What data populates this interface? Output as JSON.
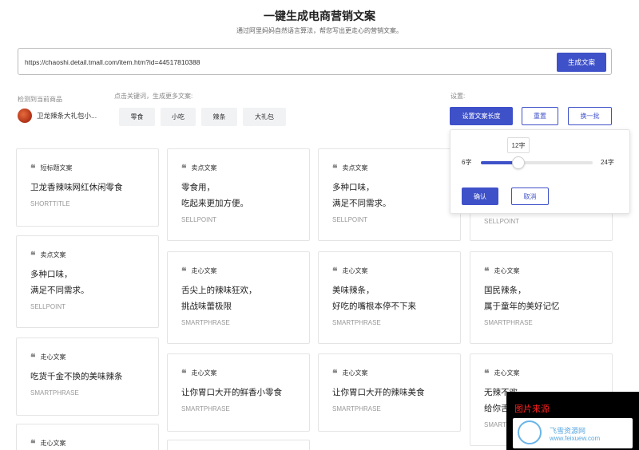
{
  "header": {
    "title": "一键生成电商营销文案",
    "subtitle": "通过阿里妈妈自然语言算法，帮您写出更走心的营销文案。"
  },
  "url_bar": {
    "value": "https://chaoshi.detail.tmall.com/item.htm?id=44517810388",
    "generate_label": "生成文案"
  },
  "product_section": {
    "label": "检测到当前商品",
    "name": "卫龙辣条大礼包小..."
  },
  "keywords_section": {
    "label": "点击关键词，生成更多文案:",
    "keywords": [
      "零食",
      "小吃",
      "辣条",
      "大礼包"
    ]
  },
  "settings": {
    "label": "设置:",
    "length_label": "设置文案长度",
    "reset_label": "重置",
    "refresh_label": "换一批"
  },
  "length_popover": {
    "current": "12字",
    "min_label": "6字",
    "max_label": "24字",
    "min": 6,
    "max": 24,
    "value": 12,
    "ok_label": "确认",
    "cancel_label": "取消"
  },
  "cards": [
    {
      "tag": "短标题文案",
      "content": "卫龙香辣味网红休闲零食",
      "type": "SHORTTITLE"
    },
    {
      "tag": "卖点文案",
      "content": "多种口味，\n满足不同需求。",
      "type": "SELLPOINT"
    },
    {
      "tag": "走心文案",
      "content": "吃货千金不换的美味辣条",
      "type": "SMARTPHRASE"
    },
    {
      "tag": "走心文案",
      "content": "",
      "type": ""
    },
    {
      "tag": "卖点文案",
      "content": "零食用，\n吃起来更加方便。",
      "type": "SELLPOINT"
    },
    {
      "tag": "走心文案",
      "content": "舌尖上的辣味狂欢，\n挑战味蕾极限",
      "type": "SMARTPHRASE"
    },
    {
      "tag": "走心文案",
      "content": "让你胃口大开的鲜香小零食",
      "type": "SMARTPHRASE"
    },
    {
      "tag": "卖点文案",
      "content": "多种口味，\n满足不同需求。",
      "type": "SELLPOINT"
    },
    {
      "tag": "走心文案",
      "content": "美味辣条，\n好吃的嘴根本停不下来",
      "type": "SMARTPHRASE"
    },
    {
      "tag": "走心文案",
      "content": "让你胃口大开的辣味美食",
      "type": "SMARTPHRASE"
    },
    {
      "tag": "",
      "content": "",
      "type": "SELLPOINT"
    },
    {
      "tag": "走心文案",
      "content": "国民辣条，\n属于童年的美好记忆",
      "type": "SMARTPHRASE"
    },
    {
      "tag": "走心文案",
      "content": "无辣不欢，\n给你舌",
      "type": "SMART"
    }
  ],
  "watermark": {
    "source": "图片来源",
    "brand": "飞雪资源网",
    "url": "www.feixuew.com"
  }
}
